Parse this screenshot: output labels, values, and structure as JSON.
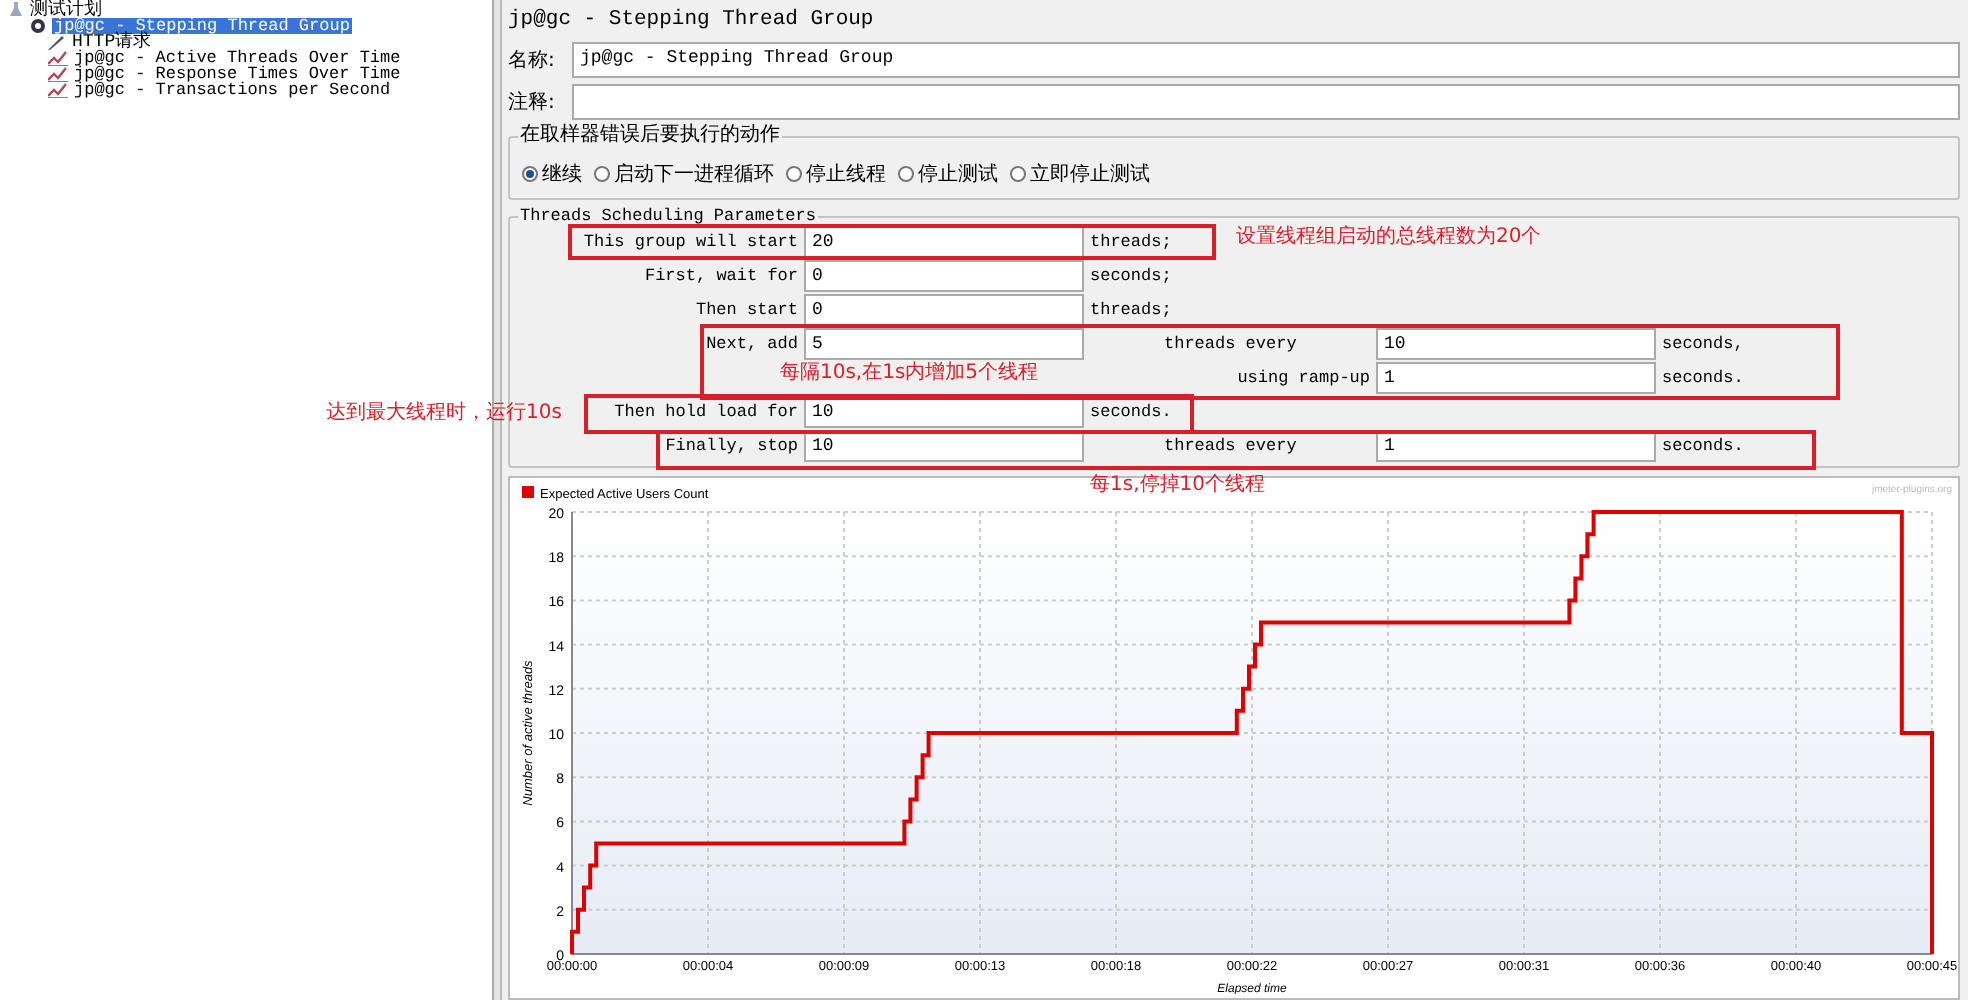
{
  "tree": [
    {
      "label": "测试计划",
      "kind": "plan",
      "selected": false,
      "children": [
        {
          "label": "jp@gc - Stepping Thread Group",
          "kind": "threadgroup",
          "selected": true,
          "children": [
            {
              "label": "HTTP请求",
              "kind": "sampler",
              "selected": false
            },
            {
              "label": "jp@gc - Active Threads Over Time",
              "kind": "listener",
              "selected": false
            },
            {
              "label": "jp@gc - Response Times Over Time",
              "kind": "listener",
              "selected": false
            },
            {
              "label": "jp@gc - Transactions per Second",
              "kind": "listener",
              "selected": false
            }
          ]
        }
      ]
    }
  ],
  "panel": {
    "title": "jp@gc - Stepping Thread Group",
    "name": {
      "label": "名称:",
      "value": "jp@gc - Stepping Thread Group"
    },
    "comment": {
      "label": "注释:"
    },
    "on_error": {
      "legend": "在取样器错误后要执行的动作",
      "options": [
        {
          "label": "继续",
          "selected": true
        },
        {
          "label": "启动下一进程循环",
          "selected": false
        },
        {
          "label": "停止线程",
          "selected": false
        },
        {
          "label": "停止测试",
          "selected": false
        },
        {
          "label": "立即停止测试",
          "selected": false
        }
      ]
    },
    "scheduling": {
      "legend": "Threads Scheduling Parameters",
      "rows": [
        {
          "kind": "basic",
          "label": "This group will start",
          "value": "20",
          "unit": "threads;"
        },
        {
          "kind": "basic",
          "label": "First, wait for",
          "value": "0",
          "unit": "seconds;"
        },
        {
          "kind": "basic",
          "label": "Then start",
          "value": "0",
          "unit": "threads;"
        },
        {
          "kind": "basic",
          "label": "Next, add",
          "value": "5",
          "unit": "",
          "every": {
            "label": "threads every",
            "value": "10",
            "unit": "seconds,"
          }
        },
        {
          "kind": "ramp",
          "label": "using ramp-up",
          "value": "1",
          "unit": "seconds."
        },
        {
          "kind": "basic",
          "label": "Then hold load for",
          "value": "10",
          "unit": "seconds."
        },
        {
          "kind": "basic",
          "label": "Finally, stop",
          "value": "10",
          "unit": "",
          "every": {
            "label": "threads every",
            "value": "1",
            "unit": "seconds."
          }
        }
      ]
    },
    "chart": {
      "attribution": "jmeter-plugins.org",
      "chart_data": {
        "type": "line",
        "grid": true,
        "xlabel": "Elapsed time",
        "ylabel": "Number of active threads",
        "xlim": [
          0,
          45
        ],
        "ylim": [
          0,
          20
        ],
        "x": [
          0,
          0,
          0.2,
          0.2,
          0.4,
          0.4,
          0.6,
          0.6,
          0.8,
          0.8,
          11,
          11,
          11.2,
          11.2,
          11.4,
          11.4,
          11.6,
          11.6,
          11.8,
          11.8,
          22,
          22,
          22.2,
          22.2,
          22.4,
          22.4,
          22.6,
          22.6,
          22.8,
          22.8,
          33,
          33,
          33.2,
          33.2,
          33.4,
          33.4,
          33.6,
          33.6,
          33.8,
          33.8,
          44,
          44,
          45,
          45
        ],
        "series": [
          {
            "name": "Expected Active Users Count",
            "color": "#e00000",
            "values": [
              0,
              1,
              1,
              2,
              2,
              3,
              3,
              4,
              4,
              5,
              5,
              6,
              6,
              7,
              7,
              8,
              8,
              9,
              9,
              10,
              10,
              11,
              11,
              12,
              12,
              13,
              13,
              14,
              14,
              15,
              15,
              16,
              16,
              17,
              17,
              18,
              18,
              19,
              19,
              20,
              20,
              10,
              10,
              0
            ]
          }
        ],
        "xticks": [
          {
            "value": 0,
            "label": "00:00:00"
          },
          {
            "value": 4.5,
            "label": "00:00:04"
          },
          {
            "value": 9,
            "label": "00:00:09"
          },
          {
            "value": 13.5,
            "label": "00:00:13"
          },
          {
            "value": 18,
            "label": "00:00:18"
          },
          {
            "value": 22.5,
            "label": "00:00:22"
          },
          {
            "value": 27,
            "label": "00:00:27"
          },
          {
            "value": 31.5,
            "label": "00:00:31"
          },
          {
            "value": 36,
            "label": "00:00:36"
          },
          {
            "value": 40.5,
            "label": "00:00:40"
          },
          {
            "value": 45,
            "label": "00:00:45"
          }
        ],
        "yticks": [
          0,
          2,
          4,
          6,
          8,
          10,
          12,
          14,
          16,
          18,
          20
        ]
      }
    }
  },
  "annotations": [
    {
      "text": "设置线程组启动的总线程数为20个"
    },
    {
      "text": "每隔10s,在1s内增加5个线程"
    },
    {
      "text": "达到最大线程时，运行10s"
    },
    {
      "text": "每1s,停掉10个线程"
    }
  ]
}
